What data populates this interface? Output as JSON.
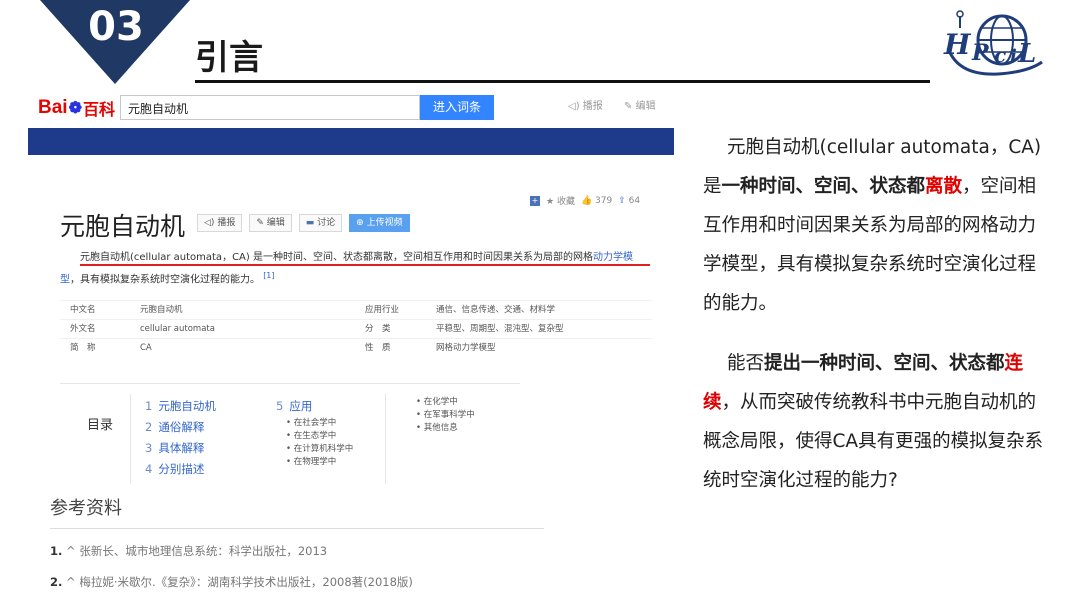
{
  "slide": {
    "section_number": "03",
    "title": "引言",
    "accent_color": "#1f3864"
  },
  "baike": {
    "logo": {
      "bai": "Bai",
      "du_paw": "du",
      "baike": "百科"
    },
    "search_value": "元胞自动机",
    "search_button": "进入词条",
    "play_link": "播报",
    "edit_link": "编辑",
    "brand_color": "#3385ff"
  },
  "entry": {
    "actions": {
      "favorite": "收藏",
      "likes": "379",
      "shares": "64"
    },
    "title": "元胞自动机",
    "buttons": {
      "play": "播报",
      "edit": "编辑",
      "discuss": "讨论",
      "upload": "上传视频"
    },
    "summary_part1": "元胞自动机(cellular automata，CA) 是一种时间、空间、状态都离散，空间相互作用和时间因果关系为局部的网格",
    "summary_link": "动力学模型",
    "summary_part2": "，具有模拟复杂系统时空演化过程的能力。",
    "summary_ref": "[1]",
    "info": [
      {
        "k1": "中文名",
        "v1": "元胞自动机",
        "k2": "应用行业",
        "v2": "通信、信息传递、交通、材料学"
      },
      {
        "k1": "外文名",
        "v1": "cellular automata",
        "k2": "分　类",
        "v2": "平稳型、周期型、混沌型、复杂型"
      },
      {
        "k1": "简　称",
        "v1": "CA",
        "k2": "性　质",
        "v2": "网格动力学模型"
      }
    ],
    "toc": {
      "label": "目录",
      "col1": [
        {
          "num": "1",
          "text": "元胞自动机"
        },
        {
          "num": "2",
          "text": "通俗解释"
        },
        {
          "num": "3",
          "text": "具体解释"
        },
        {
          "num": "4",
          "text": "分别描述"
        }
      ],
      "col2_head": {
        "num": "5",
        "text": "应用"
      },
      "col2_sub": [
        "在社会学中",
        "在生态学中",
        "在计算机科学中",
        "在物理学中"
      ],
      "col3_sub": [
        "在化学中",
        "在军事科学中",
        "其他信息"
      ]
    }
  },
  "references": {
    "title": "参考资料",
    "items": [
      {
        "num": "1.",
        "text": "张新长、城市地理信息系统：科学出版社，2013"
      },
      {
        "num": "2.",
        "text": "梅拉妮·米歇尔.《复杂》：湖南科学技术出版社，2008著(2018版)"
      }
    ]
  },
  "right_text": {
    "p1_a": "元胞自动机(cellular  automata，CA) 是",
    "p1_bold": "一种时间、空间、状态都",
    "p1_red": "离散",
    "p1_b": "，空间相互作用和时间因果关系为局部的网格动力学模型，具有模拟复杂系统时空演化过程的能力。",
    "p2_a": "能否",
    "p2_bold": "提出一种时间、空间、状态都",
    "p2_red": "连续",
    "p2_b": "，从而突破传统教科书中元胞自动机的概念局限，使得CA具有更强的模拟复杂系统时空演化过程的能力?"
  }
}
